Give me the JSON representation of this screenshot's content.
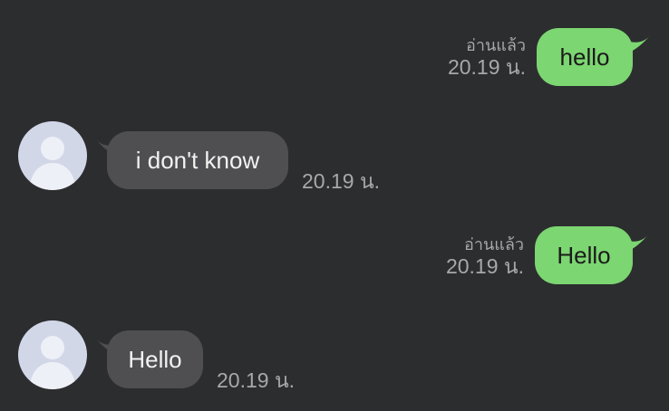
{
  "colors": {
    "background": "#2c2d2f",
    "outgoing_bubble": "#7cd671",
    "incoming_bubble": "#4f4f51",
    "avatar_bg": "#d2d7e8",
    "meta_text": "#a8a8a8"
  },
  "messages": [
    {
      "direction": "outgoing",
      "text": "hello",
      "read_label": "อ่านแล้ว",
      "time": "20.19 น."
    },
    {
      "direction": "incoming",
      "text": "i don't know",
      "time": "20.19 น.",
      "avatar_icon": "default-user-avatar-icon"
    },
    {
      "direction": "outgoing",
      "text": "Hello",
      "read_label": "อ่านแล้ว",
      "time": "20.19 น."
    },
    {
      "direction": "incoming",
      "text": "Hello",
      "time": "20.19 น.",
      "avatar_icon": "default-user-avatar-icon"
    }
  ]
}
